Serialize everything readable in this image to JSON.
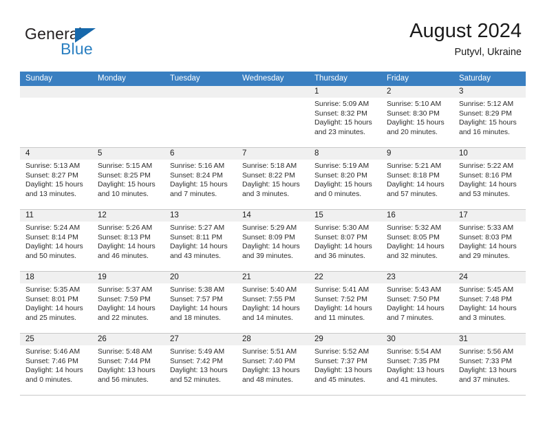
{
  "logo": {
    "word_top": "General",
    "word_bottom": "Blue",
    "triangle_color": "#1668ab",
    "blue_color": "#2a7fc1"
  },
  "header": {
    "title": "August 2024",
    "subtitle": "Putyvl, Ukraine"
  },
  "theme": {
    "header_row_bg": "#3a7fc1",
    "day_number_bg": "#f0f0f0",
    "grid_line": "#c8c8c8"
  },
  "weekdays": [
    "Sunday",
    "Monday",
    "Tuesday",
    "Wednesday",
    "Thursday",
    "Friday",
    "Saturday"
  ],
  "weeks": [
    [
      {
        "day": "",
        "lines": []
      },
      {
        "day": "",
        "lines": []
      },
      {
        "day": "",
        "lines": []
      },
      {
        "day": "",
        "lines": []
      },
      {
        "day": "1",
        "lines": [
          "Sunrise: 5:09 AM",
          "Sunset: 8:32 PM",
          "Daylight: 15 hours",
          "and 23 minutes."
        ]
      },
      {
        "day": "2",
        "lines": [
          "Sunrise: 5:10 AM",
          "Sunset: 8:30 PM",
          "Daylight: 15 hours",
          "and 20 minutes."
        ]
      },
      {
        "day": "3",
        "lines": [
          "Sunrise: 5:12 AM",
          "Sunset: 8:29 PM",
          "Daylight: 15 hours",
          "and 16 minutes."
        ]
      }
    ],
    [
      {
        "day": "4",
        "lines": [
          "Sunrise: 5:13 AM",
          "Sunset: 8:27 PM",
          "Daylight: 15 hours",
          "and 13 minutes."
        ]
      },
      {
        "day": "5",
        "lines": [
          "Sunrise: 5:15 AM",
          "Sunset: 8:25 PM",
          "Daylight: 15 hours",
          "and 10 minutes."
        ]
      },
      {
        "day": "6",
        "lines": [
          "Sunrise: 5:16 AM",
          "Sunset: 8:24 PM",
          "Daylight: 15 hours",
          "and 7 minutes."
        ]
      },
      {
        "day": "7",
        "lines": [
          "Sunrise: 5:18 AM",
          "Sunset: 8:22 PM",
          "Daylight: 15 hours",
          "and 3 minutes."
        ]
      },
      {
        "day": "8",
        "lines": [
          "Sunrise: 5:19 AM",
          "Sunset: 8:20 PM",
          "Daylight: 15 hours",
          "and 0 minutes."
        ]
      },
      {
        "day": "9",
        "lines": [
          "Sunrise: 5:21 AM",
          "Sunset: 8:18 PM",
          "Daylight: 14 hours",
          "and 57 minutes."
        ]
      },
      {
        "day": "10",
        "lines": [
          "Sunrise: 5:22 AM",
          "Sunset: 8:16 PM",
          "Daylight: 14 hours",
          "and 53 minutes."
        ]
      }
    ],
    [
      {
        "day": "11",
        "lines": [
          "Sunrise: 5:24 AM",
          "Sunset: 8:14 PM",
          "Daylight: 14 hours",
          "and 50 minutes."
        ]
      },
      {
        "day": "12",
        "lines": [
          "Sunrise: 5:26 AM",
          "Sunset: 8:13 PM",
          "Daylight: 14 hours",
          "and 46 minutes."
        ]
      },
      {
        "day": "13",
        "lines": [
          "Sunrise: 5:27 AM",
          "Sunset: 8:11 PM",
          "Daylight: 14 hours",
          "and 43 minutes."
        ]
      },
      {
        "day": "14",
        "lines": [
          "Sunrise: 5:29 AM",
          "Sunset: 8:09 PM",
          "Daylight: 14 hours",
          "and 39 minutes."
        ]
      },
      {
        "day": "15",
        "lines": [
          "Sunrise: 5:30 AM",
          "Sunset: 8:07 PM",
          "Daylight: 14 hours",
          "and 36 minutes."
        ]
      },
      {
        "day": "16",
        "lines": [
          "Sunrise: 5:32 AM",
          "Sunset: 8:05 PM",
          "Daylight: 14 hours",
          "and 32 minutes."
        ]
      },
      {
        "day": "17",
        "lines": [
          "Sunrise: 5:33 AM",
          "Sunset: 8:03 PM",
          "Daylight: 14 hours",
          "and 29 minutes."
        ]
      }
    ],
    [
      {
        "day": "18",
        "lines": [
          "Sunrise: 5:35 AM",
          "Sunset: 8:01 PM",
          "Daylight: 14 hours",
          "and 25 minutes."
        ]
      },
      {
        "day": "19",
        "lines": [
          "Sunrise: 5:37 AM",
          "Sunset: 7:59 PM",
          "Daylight: 14 hours",
          "and 22 minutes."
        ]
      },
      {
        "day": "20",
        "lines": [
          "Sunrise: 5:38 AM",
          "Sunset: 7:57 PM",
          "Daylight: 14 hours",
          "and 18 minutes."
        ]
      },
      {
        "day": "21",
        "lines": [
          "Sunrise: 5:40 AM",
          "Sunset: 7:55 PM",
          "Daylight: 14 hours",
          "and 14 minutes."
        ]
      },
      {
        "day": "22",
        "lines": [
          "Sunrise: 5:41 AM",
          "Sunset: 7:52 PM",
          "Daylight: 14 hours",
          "and 11 minutes."
        ]
      },
      {
        "day": "23",
        "lines": [
          "Sunrise: 5:43 AM",
          "Sunset: 7:50 PM",
          "Daylight: 14 hours",
          "and 7 minutes."
        ]
      },
      {
        "day": "24",
        "lines": [
          "Sunrise: 5:45 AM",
          "Sunset: 7:48 PM",
          "Daylight: 14 hours",
          "and 3 minutes."
        ]
      }
    ],
    [
      {
        "day": "25",
        "lines": [
          "Sunrise: 5:46 AM",
          "Sunset: 7:46 PM",
          "Daylight: 14 hours",
          "and 0 minutes."
        ]
      },
      {
        "day": "26",
        "lines": [
          "Sunrise: 5:48 AM",
          "Sunset: 7:44 PM",
          "Daylight: 13 hours",
          "and 56 minutes."
        ]
      },
      {
        "day": "27",
        "lines": [
          "Sunrise: 5:49 AM",
          "Sunset: 7:42 PM",
          "Daylight: 13 hours",
          "and 52 minutes."
        ]
      },
      {
        "day": "28",
        "lines": [
          "Sunrise: 5:51 AM",
          "Sunset: 7:40 PM",
          "Daylight: 13 hours",
          "and 48 minutes."
        ]
      },
      {
        "day": "29",
        "lines": [
          "Sunrise: 5:52 AM",
          "Sunset: 7:37 PM",
          "Daylight: 13 hours",
          "and 45 minutes."
        ]
      },
      {
        "day": "30",
        "lines": [
          "Sunrise: 5:54 AM",
          "Sunset: 7:35 PM",
          "Daylight: 13 hours",
          "and 41 minutes."
        ]
      },
      {
        "day": "31",
        "lines": [
          "Sunrise: 5:56 AM",
          "Sunset: 7:33 PM",
          "Daylight: 13 hours",
          "and 37 minutes."
        ]
      }
    ]
  ]
}
